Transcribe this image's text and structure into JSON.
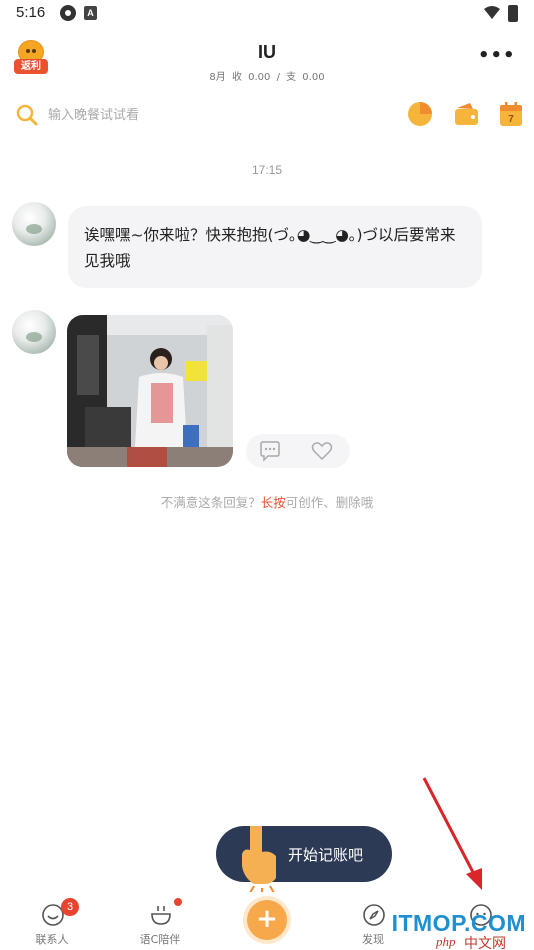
{
  "status_bar": {
    "time": "5:16",
    "icons": [
      "system-app-icon",
      "notification-a-icon",
      "wifi-icon",
      "battery-icon"
    ]
  },
  "header": {
    "bonus_badge": "返利",
    "title": "IU",
    "summary": "8月 收 0.00 / 支 0.00",
    "more_icon": "more-dots-icon"
  },
  "search": {
    "placeholder": "输入晚餐试试看",
    "quick_icons": [
      "pie-chart-icon",
      "wallet-icon",
      "calendar-icon"
    ],
    "calendar_day": "7"
  },
  "chat": {
    "time": "17:15",
    "message_text": "诶嘿嘿~你来啦？快来抱抱(づ｡◕‿‿◕｡)づ以后要常来见我哦",
    "reply_actions": [
      "comment-icon",
      "like-icon"
    ],
    "hint_before": "不满意这条回复？",
    "hint_accent": "长按",
    "hint_after": "可创作、删除哦"
  },
  "tooltip": {
    "label": "开始记账吧"
  },
  "bottom_nav": {
    "items": [
      {
        "label": "联系人",
        "icon": "smile-face-icon",
        "badge": "3"
      },
      {
        "label": "语C陪伴",
        "icon": "bowl-icon",
        "dot": true
      },
      {
        "label": "",
        "icon": "plus-icon"
      },
      {
        "label": "发现",
        "icon": "compass-icon"
      },
      {
        "label": "",
        "icon": "profile-face-icon"
      }
    ]
  },
  "watermark": {
    "main": "ITMOP.COM",
    "sub": "php",
    "cn": "中文网"
  },
  "colors": {
    "accent": "#e9512f",
    "orange": "#f6a84b",
    "tooltip_bg": "#2c3a55",
    "annotation_arrow": "#d8262a"
  }
}
